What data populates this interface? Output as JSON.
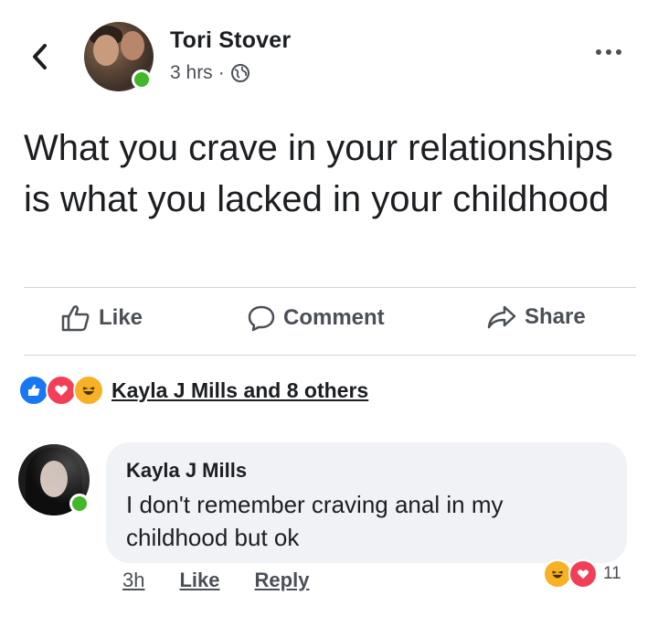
{
  "post": {
    "author": "Tori Stover",
    "time": "3 hrs",
    "separator": "·",
    "privacy_icon": "globe-icon",
    "text": "What you crave in your relationships is what you lacked in your childhood"
  },
  "actions": {
    "like": "Like",
    "comment": "Comment",
    "share": "Share"
  },
  "reactions": {
    "icons": [
      "like-icon",
      "love-icon",
      "haha-icon"
    ],
    "summary": "Kayla J Mills and 8 others"
  },
  "comment": {
    "author": "Kayla J Mills",
    "text": "I don't remember craving anal in my childhood but ok",
    "time": "3h",
    "like_label": "Like",
    "reply_label": "Reply",
    "reaction_icons": [
      "haha-icon",
      "love-icon"
    ],
    "reaction_count": "11"
  },
  "colors": {
    "like_blue": "#1877f2",
    "love_red": "#f33e58",
    "haha_yellow": "#f7b125",
    "online_green": "#42b72a",
    "bubble_gray": "#f0f2f5"
  }
}
